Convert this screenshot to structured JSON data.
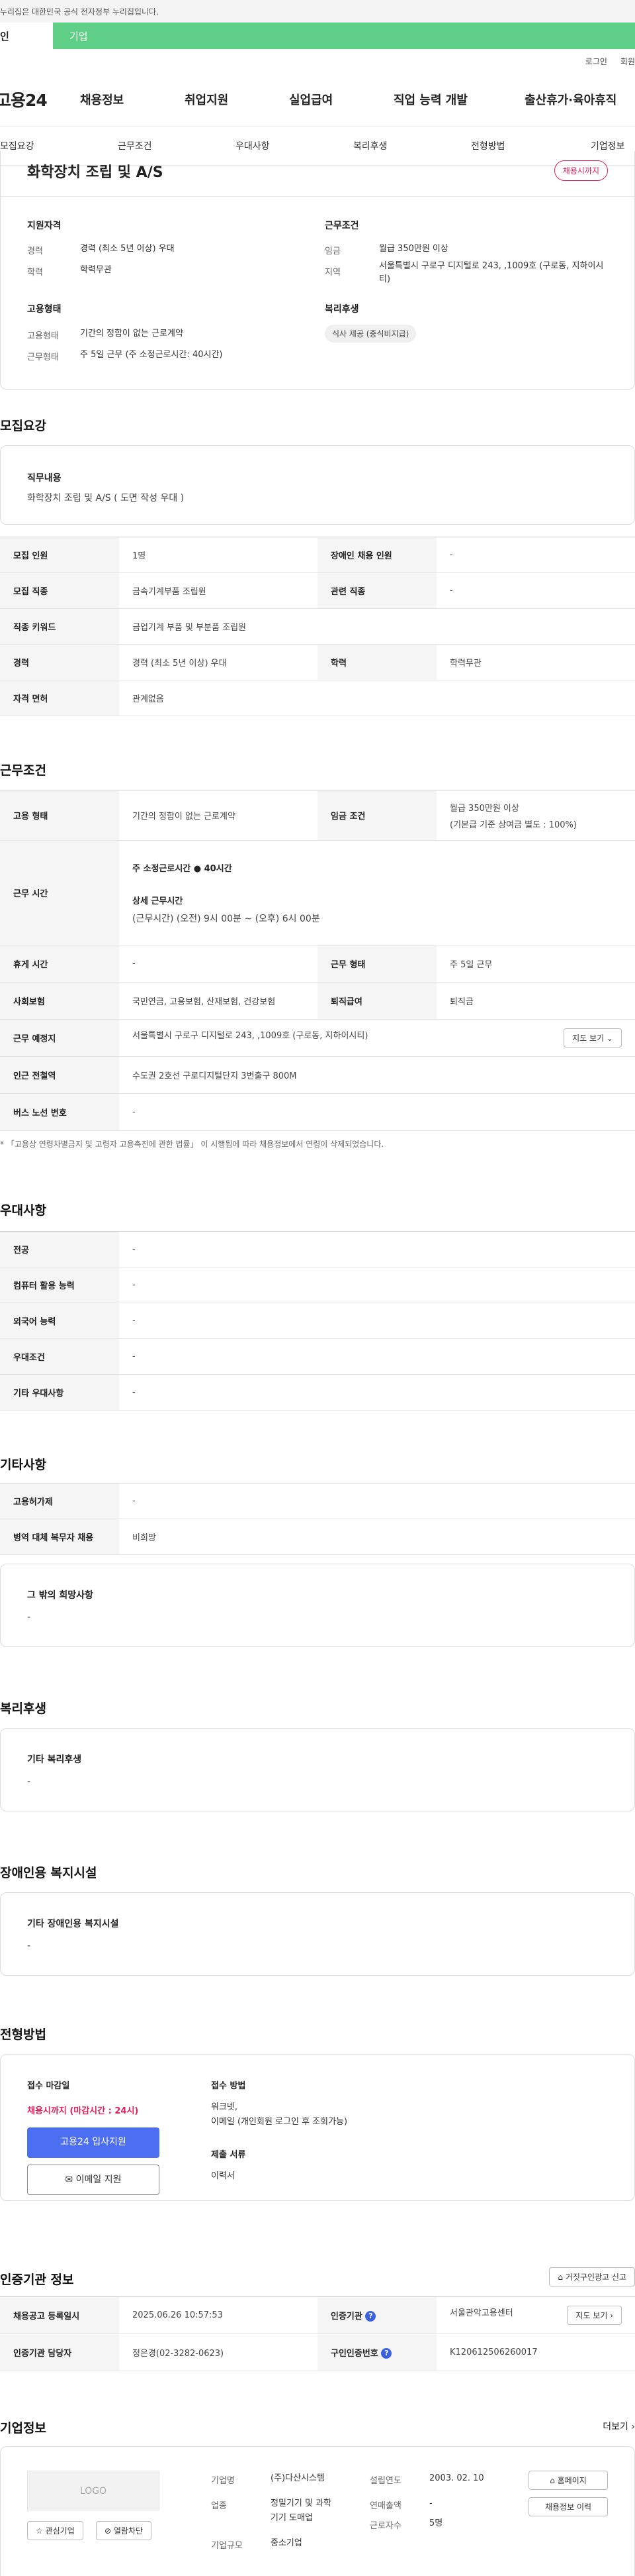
{
  "gov_notice": "누리집은 대한민국 공식 전자정부 누리집입니다.",
  "top_tabs": {
    "personal": "인",
    "corporate": "기업"
  },
  "util": {
    "login": "로그인",
    "join": "회원"
  },
  "gnb": {
    "logo": "고용24",
    "menu": [
      "채용정보",
      "취업지원",
      "실업급여",
      "직업 능력 개발",
      "출산휴가·육아휴직"
    ]
  },
  "anchors": [
    "모집요강",
    "근무조건",
    "우대사항",
    "복리후생",
    "전형방법",
    "기업정보"
  ],
  "summary": {
    "title": "화학장치 조립 및 A/S",
    "status_badge": "채용시까지",
    "support_qual": {
      "heading": "지원자격",
      "rows": [
        {
          "k": "경력",
          "v": "경력 (최소 5년 이상) 우대"
        },
        {
          "k": "학력",
          "v": "학력무관"
        }
      ]
    },
    "work_cond": {
      "heading": "근무조건",
      "rows": [
        {
          "k": "임금",
          "v": "월급 350만원 이상"
        },
        {
          "k": "지역",
          "v": "서울특별시 구로구 디지털로 243, ,1009호 (구로동, 지하이시티)"
        }
      ]
    },
    "employment": {
      "heading": "고용형태",
      "rows": [
        {
          "k": "고용형태",
          "v": "기간의 정함이 없는 근로계약"
        },
        {
          "k": "근무형태",
          "v": "주 5일 근무 (주 소정근로시간: 40시간)"
        }
      ]
    },
    "welfare": {
      "heading": "복리후생",
      "chip": "식사 제공 (중식비지급)"
    }
  },
  "recruit": {
    "heading": "모집요강",
    "duty_title": "직무내용",
    "duty_text": "화학장치 조립 및 A/S ( 도면 작성 우대 )",
    "rows": [
      {
        "k1": "모집 인원",
        "v1": "1명",
        "k2": "장애인 채용 인원",
        "v2": "-"
      },
      {
        "k1": "모집 직종",
        "v1": "금속기계부품 조립원",
        "k2": "관련 직종",
        "v2": "-"
      },
      {
        "k1": "직종 키워드",
        "v1": "금업기계 부품 및 부분품 조립원"
      },
      {
        "k1": "경력",
        "v1": "경력 (최소 5년 이상) 우대",
        "k2": "학력",
        "v2": "학력무관"
      },
      {
        "k1": "자격 면허",
        "v1": "관계없음"
      }
    ]
  },
  "conditions": {
    "heading": "근무조건",
    "emp_type_k": "고용 형태",
    "emp_type_v": "기간의 정함이 없는 근로계약",
    "wage_k": "임금 조건",
    "wage_v1": "월급 350만원 이상",
    "wage_v2": "(기본급 기준 상여금 별도 : 100%)",
    "hours_k": "근무 시간",
    "hours_total": "주 소정근로시간 ● 40시간",
    "hours_detail_title": "상세 근무시간",
    "hours_detail": "(근무시간) (오전) 9시 00분 ~ (오후) 6시 00분",
    "rest_k": "휴게 시간",
    "rest_v": "-",
    "shift_k": "근무 형태",
    "shift_v": "주 5일 근무",
    "ins_k": "사회보험",
    "ins_v": "국민연금, 고용보험, 산재보험, 건강보험",
    "sev_k": "퇴직급여",
    "sev_v": "퇴직금",
    "loc_k": "근무 예정지",
    "loc_v": "서울특별시 구로구 디지털로 243, ,1009호 (구로동, 지하이시티)",
    "map_btn": "지도 보기 ⌄",
    "subway_k": "인근 전철역",
    "subway_v": "수도권 2호선 구로디지털단지 3번출구 800M",
    "bus_k": "버스 노선 번호",
    "bus_v": "-",
    "note": "* 「고용상 연령차별금지 및 고령자 고용촉진에 관한 법률」 이 시행됨에 따라 채용정보에서 연령이 삭제되었습니다."
  },
  "preference": {
    "heading": "우대사항",
    "rows": [
      {
        "k": "전공",
        "v": "-"
      },
      {
        "k": "컴퓨터 활용 능력",
        "v": "-"
      },
      {
        "k": "외국어 능력",
        "v": "-"
      },
      {
        "k": "우대조건",
        "v": "-"
      },
      {
        "k": "기타 우대사항",
        "v": "-"
      }
    ]
  },
  "etc": {
    "heading": "기타사항",
    "rows": [
      {
        "k": "고용허가제",
        "v": "-"
      },
      {
        "k": "병역 대체 복무자 채용",
        "v": "비희망"
      }
    ],
    "other_title": "그 밖의 희망사항",
    "other_value": "-"
  },
  "welfare": {
    "heading": "복리후생",
    "title": "기타 복리후생",
    "value": "-"
  },
  "disability": {
    "heading": "장애인용 복지시설",
    "title": "기타 장애인용 복지시설",
    "value": "-"
  },
  "selection": {
    "heading": "전형방법",
    "deadline_title": "접수 마감일",
    "deadline_value": "채용시까지 (마감시간 : 24시)",
    "apply_btn": "고용24 입사지원",
    "email_btn": "이메일 지원",
    "method_title": "접수 방법",
    "method_value1": "워크넷,",
    "method_value2": "이메일 (개인회원 로그인 후 조회가능)",
    "docs_title": "제출 서류",
    "docs_value": "이력서"
  },
  "cert": {
    "heading": "인증기관 정보",
    "report_btn": "거짓구인광고 신고",
    "reg_k": "채용공고 등록일시",
    "reg_v": "2025.06.26 10:57:53",
    "org_k": "인증기관",
    "org_v": "서울관악고용센터",
    "map_btn": "지도 보기 ›",
    "mgr_k": "인증기관 담당자",
    "mgr_v": "정은경(02-3282-0623)",
    "num_k": "구인인증번호",
    "num_v": "K120612506260017"
  },
  "company": {
    "heading": "기업정보",
    "more": "더보기 ›",
    "logo_text": "LOGO",
    "fav_btn": "☆ 관심기업",
    "block_btn": "⊘ 열람차단",
    "name_k": "기업명",
    "name_v": "(주)다산시스템",
    "biz_k": "업종",
    "biz_v1": "정밀기기 및 과학",
    "biz_v2": "기기 도매업",
    "size_k": "기업규모",
    "size_v": "중소기업",
    "founded_k": "설립연도",
    "founded_v": "2003. 02. 10",
    "sales_k": "연매출액",
    "sales_v": "-",
    "emp_k": "근로자수",
    "emp_v": "5명",
    "home_btn": "홈페이지",
    "history_btn": "채용정보 이력"
  }
}
